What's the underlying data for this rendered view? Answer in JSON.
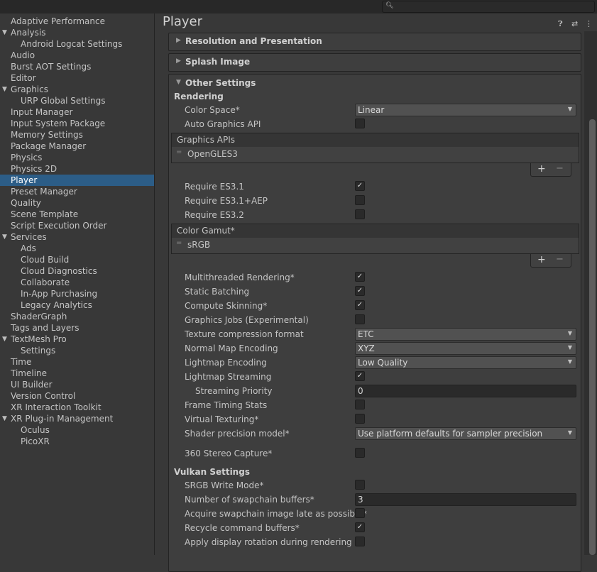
{
  "search": {
    "placeholder": ""
  },
  "sidebar": {
    "items": [
      {
        "label": "Adaptive Performance"
      },
      {
        "label": "Analysis"
      },
      {
        "label": "Android Logcat Settings"
      },
      {
        "label": "Audio"
      },
      {
        "label": "Burst AOT Settings"
      },
      {
        "label": "Editor"
      },
      {
        "label": "Graphics"
      },
      {
        "label": "URP Global Settings"
      },
      {
        "label": "Input Manager"
      },
      {
        "label": "Input System Package"
      },
      {
        "label": "Memory Settings"
      },
      {
        "label": "Package Manager"
      },
      {
        "label": "Physics"
      },
      {
        "label": "Physics 2D"
      },
      {
        "label": "Player"
      },
      {
        "label": "Preset Manager"
      },
      {
        "label": "Quality"
      },
      {
        "label": "Scene Template"
      },
      {
        "label": "Script Execution Order"
      },
      {
        "label": "Services"
      },
      {
        "label": "Ads"
      },
      {
        "label": "Cloud Build"
      },
      {
        "label": "Cloud Diagnostics"
      },
      {
        "label": "Collaborate"
      },
      {
        "label": "In-App Purchasing"
      },
      {
        "label": "Legacy Analytics"
      },
      {
        "label": "ShaderGraph"
      },
      {
        "label": "Tags and Layers"
      },
      {
        "label": "TextMesh Pro"
      },
      {
        "label": "Settings"
      },
      {
        "label": "Time"
      },
      {
        "label": "Timeline"
      },
      {
        "label": "UI Builder"
      },
      {
        "label": "Version Control"
      },
      {
        "label": "XR Interaction Toolkit"
      },
      {
        "label": "XR Plug-in Management"
      },
      {
        "label": "Oculus"
      },
      {
        "label": "PicoXR"
      }
    ]
  },
  "main": {
    "title": "Player",
    "foldouts": {
      "resolution": "Resolution and Presentation",
      "splash": "Splash Image",
      "other": "Other Settings"
    },
    "rendering": {
      "section": "Rendering",
      "color_space": {
        "label": "Color Space*",
        "value": "Linear"
      },
      "auto_graphics_api": {
        "label": "Auto Graphics API",
        "checked": false
      },
      "graphics_apis": {
        "header": "Graphics APIs",
        "items": [
          "OpenGLES3"
        ]
      },
      "require_es31": {
        "label": "Require ES3.1",
        "checked": true
      },
      "require_es31_aep": {
        "label": "Require ES3.1+AEP",
        "checked": false
      },
      "require_es32": {
        "label": "Require ES3.2",
        "checked": false
      },
      "color_gamut": {
        "header": "Color Gamut*",
        "items": [
          "sRGB"
        ]
      },
      "multithreaded_rendering": {
        "label": "Multithreaded Rendering*",
        "checked": true
      },
      "static_batching": {
        "label": "Static Batching",
        "checked": true
      },
      "compute_skinning": {
        "label": "Compute Skinning*",
        "checked": true
      },
      "graphics_jobs": {
        "label": "Graphics Jobs (Experimental)",
        "checked": false
      },
      "texture_compression": {
        "label": "Texture compression format",
        "value": "ETC"
      },
      "normal_map_encoding": {
        "label": "Normal Map Encoding",
        "value": "XYZ"
      },
      "lightmap_encoding": {
        "label": "Lightmap Encoding",
        "value": "Low Quality"
      },
      "lightmap_streaming": {
        "label": "Lightmap Streaming",
        "checked": true
      },
      "streaming_priority": {
        "label": "Streaming Priority",
        "value": "0"
      },
      "frame_timing_stats": {
        "label": "Frame Timing Stats",
        "checked": false
      },
      "virtual_texturing": {
        "label": "Virtual Texturing*",
        "checked": false
      },
      "shader_precision": {
        "label": "Shader precision model*",
        "value": "Use platform defaults for sampler precision"
      },
      "stereo_capture": {
        "label": "360 Stereo Capture*",
        "checked": false
      }
    },
    "vulkan": {
      "section": "Vulkan Settings",
      "srgb_write_mode": {
        "label": "SRGB Write Mode*",
        "checked": false
      },
      "swapchain_buffers": {
        "label": "Number of swapchain buffers*",
        "value": "3"
      },
      "acquire_late": {
        "label": "Acquire swapchain image late as possible*",
        "checked": false
      },
      "recycle_buffers": {
        "label": "Recycle command buffers*",
        "checked": true
      },
      "display_rotation": {
        "label": "Apply display rotation during rendering",
        "checked": false
      }
    }
  },
  "icons": {
    "check": "✓",
    "dropdown": "▼",
    "collapsed": "▶",
    "expanded": "▼",
    "plus": "+",
    "minus": "−",
    "handle": "="
  },
  "colors": {
    "selection": "#2c5d87",
    "background": "#383838",
    "panel": "#3e3e3e"
  }
}
